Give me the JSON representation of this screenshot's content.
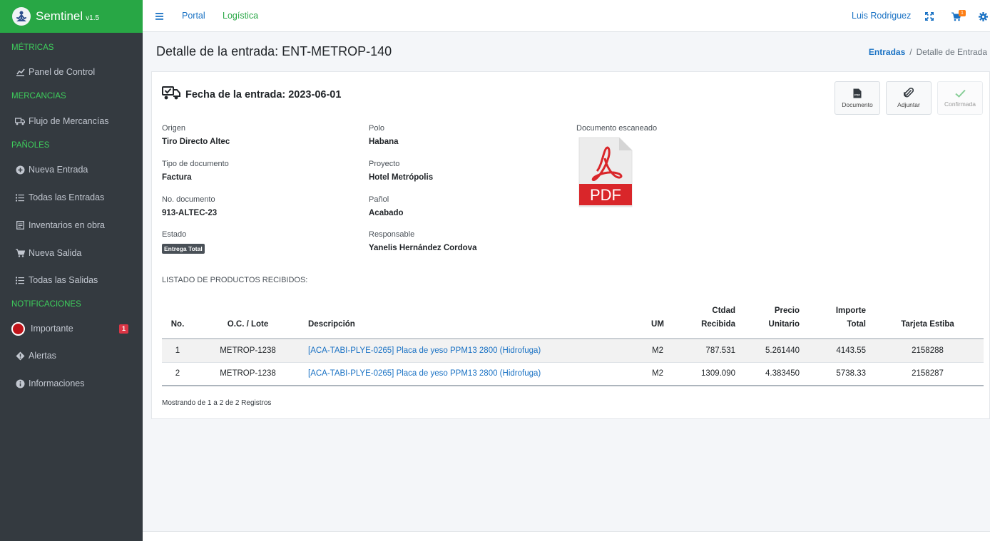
{
  "brand": {
    "name": "Semtinel",
    "version": "v1.5",
    "logo_icon": "yoga-person-icon"
  },
  "sidebar": {
    "headers": [
      "MÉTRICAS",
      "MERCANCIAS",
      "PAÑOLES",
      "NOTIFICACIONES"
    ],
    "items": [
      {
        "label": "Panel de Control",
        "icon": "chart-icon"
      },
      {
        "label": "Flujo de Mercancías",
        "icon": "truck-icon"
      },
      {
        "label": "Nueva Entrada",
        "icon": "plus-circle-icon"
      },
      {
        "label": "Todas las Entradas",
        "icon": "list-icon"
      },
      {
        "label": "Inventarios en obra",
        "icon": "clipboard-icon"
      },
      {
        "label": "Nueva Salida",
        "icon": "cart-icon"
      },
      {
        "label": "Todas las Salidas",
        "icon": "list-icon"
      },
      {
        "label": "Importante",
        "icon": "red-circle-icon",
        "badge": "1"
      },
      {
        "label": "Alertas",
        "icon": "diamond-alert-icon"
      },
      {
        "label": "Informaciones",
        "icon": "info-icon"
      }
    ]
  },
  "topbar": {
    "links": [
      "Portal",
      "Logística"
    ],
    "user": "Luis Rodriguez",
    "cart_count": "1"
  },
  "page": {
    "title": "Detalle de la entrada: ENT-METROP-140",
    "breadcrumb": [
      "Entradas",
      "Detalle de Entrada"
    ]
  },
  "card": {
    "title": "Fecha de la entrada: 2023-06-01",
    "actions": [
      {
        "label": "Documento",
        "icon": "pdf-file-icon",
        "enabled": true
      },
      {
        "label": "Adjuntar",
        "icon": "paperclip-icon",
        "enabled": true
      },
      {
        "label": "Confirmada",
        "icon": "check-icon",
        "enabled": false
      }
    ],
    "fields": {
      "origen": {
        "label": "Origen",
        "value": "Tiro Directo Altec"
      },
      "tipo_documento": {
        "label": "Tipo de documento",
        "value": "Factura"
      },
      "no_documento": {
        "label": "No. documento",
        "value": "913-ALTEC-23"
      },
      "estado": {
        "label": "Estado",
        "value": "Entrega Total"
      },
      "polo": {
        "label": "Polo",
        "value": "Habana"
      },
      "proyecto": {
        "label": "Proyecto",
        "value": "Hotel Metrópolis"
      },
      "panol": {
        "label": "Pañol",
        "value": "Acabado"
      },
      "responsable": {
        "label": "Responsable",
        "value": "Yanelis Hernández Cordova"
      },
      "documento_escaneado": {
        "label": "Documento escaneado",
        "file_label": "PDF"
      }
    },
    "list_label": "LISTADO DE PRODUCTOS RECIBIDOS:",
    "table": {
      "headers": {
        "no": "No.",
        "oc": "O.C. / Lote",
        "desc": "Descripción",
        "um": "UM",
        "ctdad_1": "Ctdad",
        "ctdad_2": "Recibida",
        "precio_1": "Precio",
        "precio_2": "Unitario",
        "importe_1": "Importe",
        "importe_2": "Total",
        "tarjeta": "Tarjeta Estiba"
      },
      "rows": [
        {
          "no": "1",
          "oc": "METROP-1238",
          "desc": "[ACA-TABI-PLYE-0265] Placa de yeso PPM13 2800 (Hidrofuga)",
          "um": "M2",
          "ctdad": "787.531",
          "precio": "5.261440",
          "importe": "4143.55",
          "tarjeta": "2158288"
        },
        {
          "no": "2",
          "oc": "METROP-1238",
          "desc": "[ACA-TABI-PLYE-0265] Placa de yeso PPM13 2800 (Hidrofuga)",
          "um": "M2",
          "ctdad": "1309.090",
          "precio": "4.383450",
          "importe": "5738.33",
          "tarjeta": "2158287"
        }
      ]
    },
    "showing": "Mostrando de 1 a 2 de 2 Registros"
  },
  "colors": {
    "brand_green": "#28a745",
    "sidebar_bg": "#343a40",
    "link_blue": "#1a72c4",
    "badge_red": "#dc3545",
    "pdf_red": "#d9262a"
  }
}
